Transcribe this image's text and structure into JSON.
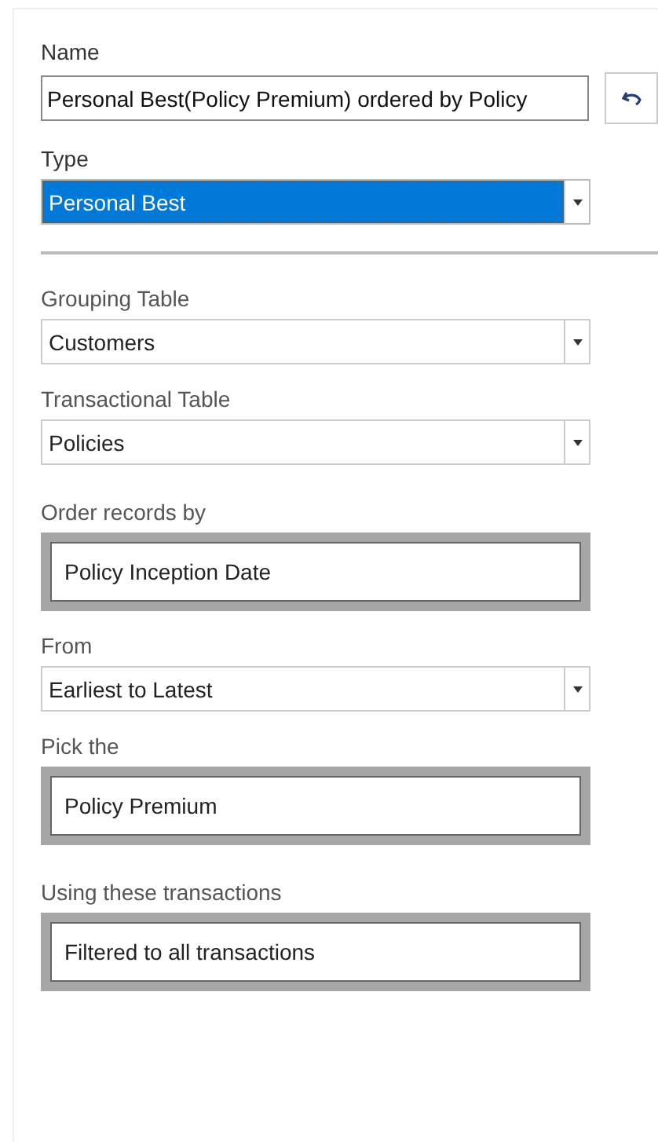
{
  "name": {
    "label": "Name",
    "value": "Personal Best(Policy Premium) ordered by Policy"
  },
  "type": {
    "label": "Type",
    "value": "Personal Best",
    "highlighted": true
  },
  "sections": [
    {
      "fields": [
        {
          "kind": "dropdown",
          "label": "Grouping Table",
          "value": "Customers"
        },
        {
          "kind": "dropdown",
          "label": "Transactional Table",
          "value": "Policies"
        }
      ]
    },
    {
      "fields": [
        {
          "kind": "picker",
          "label": "Order records by",
          "value": "Policy Inception Date"
        },
        {
          "kind": "dropdown",
          "label": "From",
          "value": "Earliest to Latest"
        },
        {
          "kind": "picker",
          "label": "Pick the",
          "value": "Policy Premium"
        }
      ]
    },
    {
      "fields": [
        {
          "kind": "picker",
          "label": "Using these transactions",
          "value": "Filtered to all transactions"
        }
      ]
    }
  ]
}
